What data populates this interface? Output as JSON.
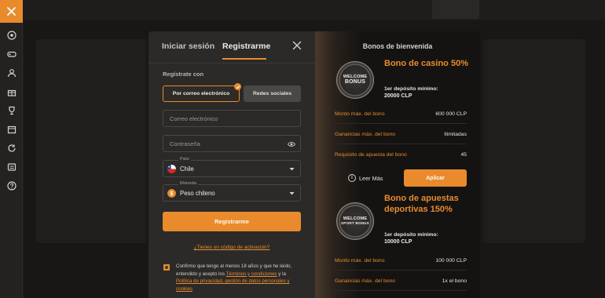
{
  "sidebar": {
    "items": [
      "close-icon",
      "soccer-ball-icon",
      "gamepad-icon",
      "dealer-icon",
      "gift-icon",
      "trophy-icon",
      "calendar-icon",
      "refresh-icon",
      "scoreboard-icon",
      "help-icon"
    ]
  },
  "modal": {
    "tab_login": "Iniciar sesión",
    "tab_register": "Registrarme",
    "register_with_label": "Regístrate con",
    "toggle_email": "Por correo electrónico",
    "toggle_social": "Redes sociales",
    "email_placeholder": "Correo electrónico",
    "password_placeholder": "Contraseña",
    "country_label": "País",
    "country_value": "Chile",
    "currency_label": "Moneda",
    "currency_value": "Peso chileno",
    "register_button": "Registrarme",
    "activation_link": "¿Tienes un código de activación?",
    "consent_prefix": "Confirmo que tengo al menos 18 años y que he leído, entendido y acepto los",
    "consent_terms": "Términos y condiciones",
    "consent_and": "y la",
    "consent_privacy": "Política de privacidad, gestión de datos personales y cookies",
    "accent_color": "#e98b2c"
  },
  "bonus_panel": {
    "heading": "Bonos de bienvenida",
    "casino": {
      "medal_text_1": "WELCOME",
      "medal_text_2": "BONUS",
      "title": "Bono de casino 50%",
      "min_deposit_label": "1er depósito mínimo:",
      "min_deposit_value": "20000 CLP",
      "rows": [
        {
          "label": "Monto máx. del bono",
          "value": "600 000 CLP"
        },
        {
          "label": "Ganancias máx. del bono",
          "value": "Ilimitadas"
        },
        {
          "label": "Requisito de apuesta del bono",
          "value": "45"
        }
      ],
      "more_link": "Leer Más",
      "apply_button": "Aplicar"
    },
    "sports": {
      "medal_text_1": "WELCOME",
      "medal_text_2": "SPORT BONUS",
      "title": "Bono de apuestas deportivas 150%",
      "min_deposit_label": "1er depósito mínimo:",
      "min_deposit_value": "10000 CLP",
      "rows": [
        {
          "label": "Monto máx. del bono",
          "value": "100 000 CLP"
        },
        {
          "label": "Ganancias máx. del bono",
          "value": "1x el bono"
        }
      ]
    }
  }
}
